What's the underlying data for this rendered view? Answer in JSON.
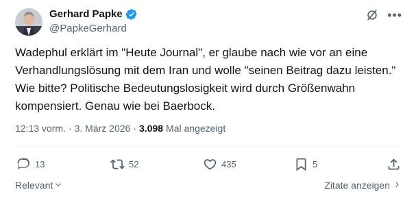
{
  "author": {
    "display_name": "Gerhard Papke",
    "handle": "@PapkeGerhard",
    "verified": true
  },
  "post": {
    "text": "Wadephul erklärt im \"Heute Journal\", er glaube nach wie vor an eine Verhandlungslösung mit dem Iran und wolle \"seinen Beitrag dazu leisten.\" Wie bitte? Politische Bedeutungslosigkeit wird durch Größenwahn kompensiert. Genau wie bei Baerbock.",
    "time": "12:13 vorm.",
    "date": "3. März 2026",
    "views_count": "3.098",
    "views_label": "Mal angezeigt"
  },
  "actions": {
    "replies": "13",
    "reposts": "52",
    "likes": "435",
    "bookmarks": "5"
  },
  "footer": {
    "sort_label": "Relevant",
    "quotes_label": "Zitate anzeigen"
  },
  "icons": {
    "verified": "verified-badge-icon",
    "grok": "grok-icon",
    "more": "more-icon",
    "reply": "reply-icon",
    "repost": "repost-icon",
    "like": "heart-icon",
    "bookmark": "bookmark-icon",
    "share": "share-icon"
  },
  "colors": {
    "verified_blue": "#1d9bf0",
    "text_primary": "#0f1419",
    "text_secondary": "#536471"
  }
}
